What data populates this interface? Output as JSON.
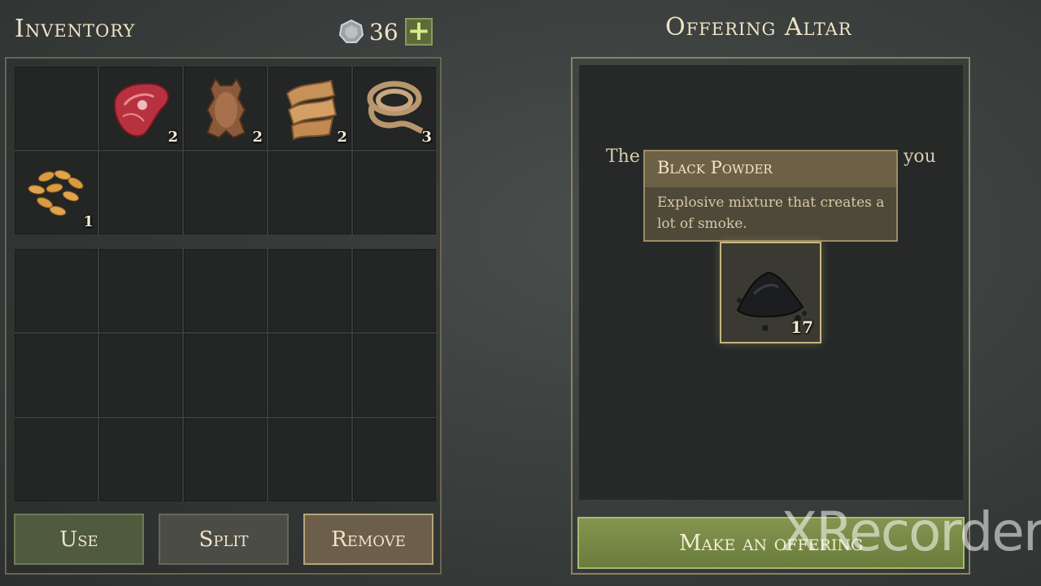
{
  "inventory": {
    "title": "Inventory",
    "currency_count": "36",
    "plus_label": "+",
    "slots_top": [
      {
        "item": "",
        "qty": ""
      },
      {
        "item": "raw-meat",
        "qty": "2"
      },
      {
        "item": "animal-hide",
        "qty": "2"
      },
      {
        "item": "cloth-roll",
        "qty": "2"
      },
      {
        "item": "rope",
        "qty": "3"
      },
      {
        "item": "seeds",
        "qty": "1"
      },
      {
        "item": "",
        "qty": ""
      },
      {
        "item": "",
        "qty": ""
      },
      {
        "item": "",
        "qty": ""
      },
      {
        "item": "",
        "qty": ""
      }
    ],
    "buttons": {
      "use": "Use",
      "split": "Split",
      "remove": "Remove"
    }
  },
  "altar": {
    "title": "Offering Altar",
    "text_left": "The",
    "text_right": "you",
    "tooltip": {
      "title": "Black Powder",
      "description": "Explosive mixture that creates a lot of smoke."
    },
    "offered_item": {
      "item": "black-powder",
      "qty": "17"
    },
    "offer_button": "Make an offering"
  },
  "watermark": "XRecorder",
  "colors": {
    "accent_green": "#7a8c45",
    "gold_border": "#c8b57f",
    "panel_dark": "#232624"
  }
}
